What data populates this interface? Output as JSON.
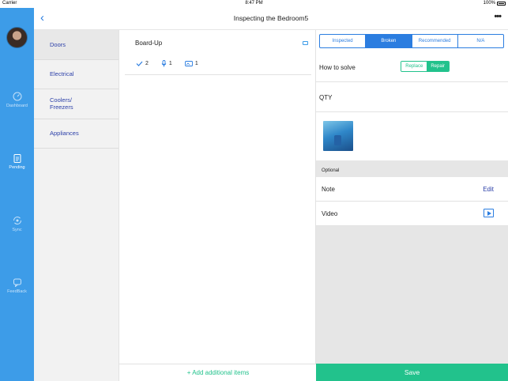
{
  "status_bar": {
    "carrier": "Carrier",
    "time": "8:47 PM",
    "battery": "100%"
  },
  "header": {
    "title": "Inspecting the Bedroom5",
    "more_label": "•••"
  },
  "sidebar": {
    "items": [
      {
        "label": "Dashboard",
        "icon": "dashboard-icon"
      },
      {
        "label": "Pending",
        "icon": "clipboard-icon"
      },
      {
        "label": "Sync",
        "icon": "sync-icon"
      },
      {
        "label": "FeedBack",
        "icon": "feedback-icon"
      }
    ]
  },
  "categories": [
    "Doors",
    "Electrical",
    "Coolers/\nFreezers",
    "Appliances"
  ],
  "item": {
    "title": "Board-Up",
    "stats": {
      "checks": "2",
      "voice": "1",
      "photos": "1"
    }
  },
  "add_items_label": "+ Add additional items",
  "status_tabs": [
    "Inspected",
    "Broken",
    "Recommended",
    "N/A"
  ],
  "status_tab_active": "Broken",
  "how_to_solve": {
    "label": "How to solve",
    "options": [
      "Replace",
      "Repair"
    ],
    "selected": "Repair"
  },
  "qty_label": "QTY",
  "optional_label": "Optional",
  "note": {
    "label": "Note",
    "action": "Edit"
  },
  "video": {
    "label": "Video"
  },
  "save_label": "Save",
  "colors": {
    "rail": "#3d9ce8",
    "accent_blue": "#2b7de0",
    "accent_green": "#22c28c",
    "link": "#2b3fa8"
  }
}
